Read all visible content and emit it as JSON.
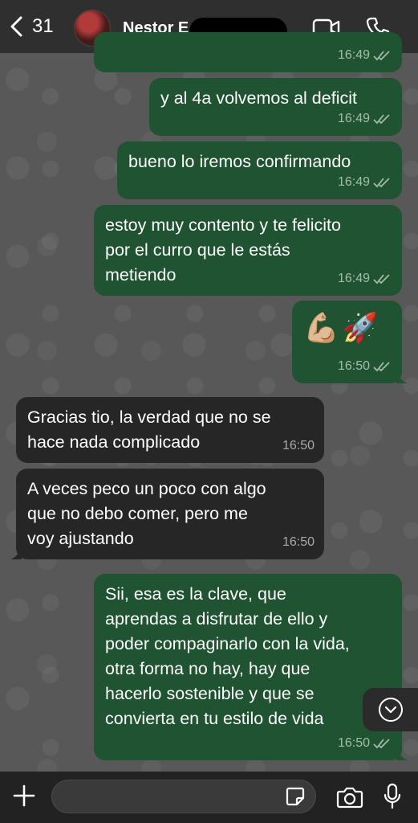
{
  "header": {
    "back_count": "31",
    "contact_name": "Nestor E"
  },
  "messages": [
    {
      "text": "",
      "time": "16:49",
      "direction": "out"
    },
    {
      "text": "y al 4a volvemos al deficit",
      "time": "16:49",
      "direction": "out"
    },
    {
      "text": "bueno lo iremos confirmando",
      "time": "16:49",
      "direction": "out"
    },
    {
      "lines": [
        "estoy muy contento y te felicito",
        "por el curro que le estás",
        "metiendo"
      ],
      "time": "16:49",
      "direction": "out"
    },
    {
      "emoji": "💪🏼🚀",
      "time": "16:50",
      "direction": "out"
    },
    {
      "lines": [
        "Gracias tio, la verdad que no se",
        "hace nada complicado"
      ],
      "time": "16:50",
      "direction": "in"
    },
    {
      "lines": [
        "A veces peco un poco con algo",
        "que no debo comer, pero me",
        "voy ajustando"
      ],
      "time": "16:50",
      "direction": "in"
    },
    {
      "lines": [
        "Sii, esa es la clave, que",
        "aprendas a disfrutar de ello y",
        "poder compaginarlo con la vida,",
        "otra forma no hay, hay que",
        "hacerlo sostenible y que se",
        "convierta en tu estilo de vida"
      ],
      "time": "16:50",
      "direction": "out"
    }
  ],
  "composer": {
    "input_value": ""
  },
  "colors": {
    "outgoing_bubble": "#1f5331",
    "incoming_bubble": "#262626",
    "header_bg": "#2f2f2f"
  },
  "icons": [
    "back-chevron-icon",
    "video-call-icon",
    "phone-icon",
    "read-ticks-icon",
    "chevron-down-icon",
    "plus-icon",
    "sticker-icon",
    "camera-icon",
    "microphone-icon"
  ]
}
